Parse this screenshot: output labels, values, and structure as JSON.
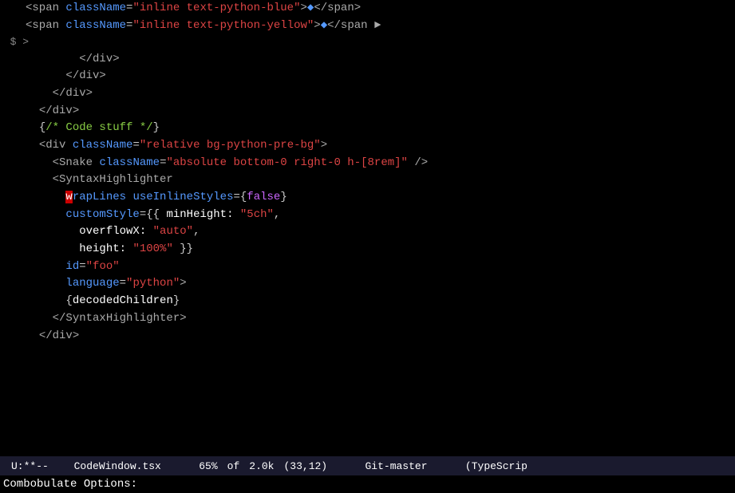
{
  "editor": {
    "lines": [
      {
        "num": "",
        "tokens": [
          {
            "text": "              ",
            "class": ""
          },
          {
            "text": "<span",
            "class": "c-tag"
          },
          {
            "text": " ",
            "class": ""
          },
          {
            "text": "className",
            "class": "c-attr"
          },
          {
            "text": "=",
            "class": "c-punct"
          },
          {
            "text": "\"inline text-python-blue\"",
            "class": "c-val-red"
          },
          {
            "text": ">",
            "class": "c-tag"
          },
          {
            "text": "◆",
            "class": "c-val-blue"
          },
          {
            "text": "</span>",
            "class": "c-tag"
          }
        ]
      },
      {
        "num": "",
        "tokens": [
          {
            "text": "              ",
            "class": ""
          },
          {
            "text": "<span",
            "class": "c-tag"
          },
          {
            "text": " ",
            "class": ""
          },
          {
            "text": "className",
            "class": "c-attr"
          },
          {
            "text": "=",
            "class": "c-punct"
          },
          {
            "text": "\"inline text-python-yellow\"",
            "class": "c-val-red"
          },
          {
            "text": ">",
            "class": "c-tag"
          },
          {
            "text": "◆",
            "class": "c-val-blue"
          },
          {
            "text": "</span",
            "class": "c-tag"
          },
          {
            "text": " ►",
            "class": "c-gray"
          }
        ]
      },
      {
        "num": "$ >",
        "tokens": [
          {
            "text": "",
            "class": ""
          }
        ]
      },
      {
        "num": "",
        "tokens": [
          {
            "text": "        ",
            "class": ""
          },
          {
            "text": "</div>",
            "class": "c-tag"
          }
        ]
      },
      {
        "num": "",
        "tokens": [
          {
            "text": "      ",
            "class": ""
          },
          {
            "text": "</div>",
            "class": "c-tag"
          }
        ]
      },
      {
        "num": "",
        "tokens": [
          {
            "text": "    ",
            "class": ""
          },
          {
            "text": "</div>",
            "class": "c-tag"
          }
        ]
      },
      {
        "num": "",
        "tokens": [
          {
            "text": "  ",
            "class": ""
          },
          {
            "text": "</div>",
            "class": "c-tag"
          }
        ]
      },
      {
        "num": "",
        "tokens": [
          {
            "text": "  ",
            "class": ""
          },
          {
            "text": "{",
            "class": "c-punct"
          },
          {
            "text": "/* Code stuff */",
            "class": "c-comment"
          },
          {
            "text": "}",
            "class": "c-punct"
          }
        ]
      },
      {
        "num": "",
        "tokens": [
          {
            "text": "  ",
            "class": ""
          },
          {
            "text": "<div",
            "class": "c-tag"
          },
          {
            "text": " ",
            "class": ""
          },
          {
            "text": "className",
            "class": "c-attr"
          },
          {
            "text": "=",
            "class": "c-punct"
          },
          {
            "text": "\"relative bg-python-pre-bg\"",
            "class": "c-val-red"
          },
          {
            "text": ">",
            "class": "c-tag"
          }
        ]
      },
      {
        "num": "",
        "tokens": [
          {
            "text": "    ",
            "class": ""
          },
          {
            "text": "<Snake",
            "class": "c-tag"
          },
          {
            "text": " ",
            "class": ""
          },
          {
            "text": "className",
            "class": "c-attr"
          },
          {
            "text": "=",
            "class": "c-punct"
          },
          {
            "text": "\"absolute bottom-0 right-0 h-[8rem]\"",
            "class": "c-val-red"
          },
          {
            "text": " />",
            "class": "c-tag"
          }
        ]
      },
      {
        "num": "",
        "tokens": [
          {
            "text": "    ",
            "class": ""
          },
          {
            "text": "<SyntaxHighlighter",
            "class": "c-tag"
          }
        ]
      },
      {
        "num": "",
        "tokens": [
          {
            "text": "      ",
            "class": ""
          },
          {
            "text": "CURSOR",
            "class": "cursor"
          },
          {
            "text": "rapLines",
            "class": "c-attr"
          },
          {
            "text": " ",
            "class": ""
          },
          {
            "text": "useInlineStyles",
            "class": "c-attr"
          },
          {
            "text": "=",
            "class": "c-punct"
          },
          {
            "text": "{",
            "class": "c-punct"
          },
          {
            "text": "false",
            "class": "c-keyword"
          },
          {
            "text": "}",
            "class": "c-punct"
          }
        ]
      },
      {
        "num": "",
        "tokens": [
          {
            "text": "      ",
            "class": ""
          },
          {
            "text": "customStyle",
            "class": "c-attr"
          },
          {
            "text": "=",
            "class": "c-punct"
          },
          {
            "text": "{{",
            "class": "c-punct"
          },
          {
            "text": " minHeight: ",
            "class": "c-white"
          },
          {
            "text": "\"5ch\"",
            "class": "c-val-red"
          },
          {
            "text": ",",
            "class": "c-punct"
          }
        ]
      },
      {
        "num": "",
        "tokens": [
          {
            "text": "        ",
            "class": ""
          },
          {
            "text": "overflowX: ",
            "class": "c-white"
          },
          {
            "text": "\"auto\"",
            "class": "c-val-red"
          },
          {
            "text": ",",
            "class": "c-punct"
          }
        ]
      },
      {
        "num": "",
        "tokens": [
          {
            "text": "        ",
            "class": ""
          },
          {
            "text": "height: ",
            "class": "c-white"
          },
          {
            "text": "\"100%\"",
            "class": "c-val-red"
          },
          {
            "text": " }}",
            "class": "c-punct"
          }
        ]
      },
      {
        "num": "",
        "tokens": [
          {
            "text": "      ",
            "class": ""
          },
          {
            "text": "id",
            "class": "c-attr"
          },
          {
            "text": "=",
            "class": "c-punct"
          },
          {
            "text": "\"foo\"",
            "class": "c-val-red"
          }
        ]
      },
      {
        "num": "",
        "tokens": [
          {
            "text": "      ",
            "class": ""
          },
          {
            "text": "language",
            "class": "c-attr"
          },
          {
            "text": "=",
            "class": "c-punct"
          },
          {
            "text": "\"python\"",
            "class": "c-val-red"
          },
          {
            "text": ">",
            "class": "c-tag"
          }
        ]
      },
      {
        "num": "",
        "tokens": [
          {
            "text": "      ",
            "class": ""
          },
          {
            "text": "{",
            "class": "c-punct"
          },
          {
            "text": "decodedChildren",
            "class": "c-white"
          },
          {
            "text": "}",
            "class": "c-punct"
          }
        ]
      },
      {
        "num": "",
        "tokens": [
          {
            "text": "    ",
            "class": ""
          },
          {
            "text": "</SyntaxHighlighter>",
            "class": "c-tag"
          }
        ]
      },
      {
        "num": "",
        "tokens": [
          {
            "text": "  ",
            "class": ""
          },
          {
            "text": "</div>",
            "class": "c-tag"
          }
        ]
      }
    ]
  },
  "status_bar": {
    "mode": "U:**--",
    "filename": "CodeWindow.tsx",
    "percent": "65%",
    "of_label": "of",
    "size": "2.0k",
    "position": "(33,12)",
    "branch": "Git-master",
    "filetype": "(TypeScrip"
  },
  "cmd_line": {
    "text": "Combobulate Options:"
  }
}
